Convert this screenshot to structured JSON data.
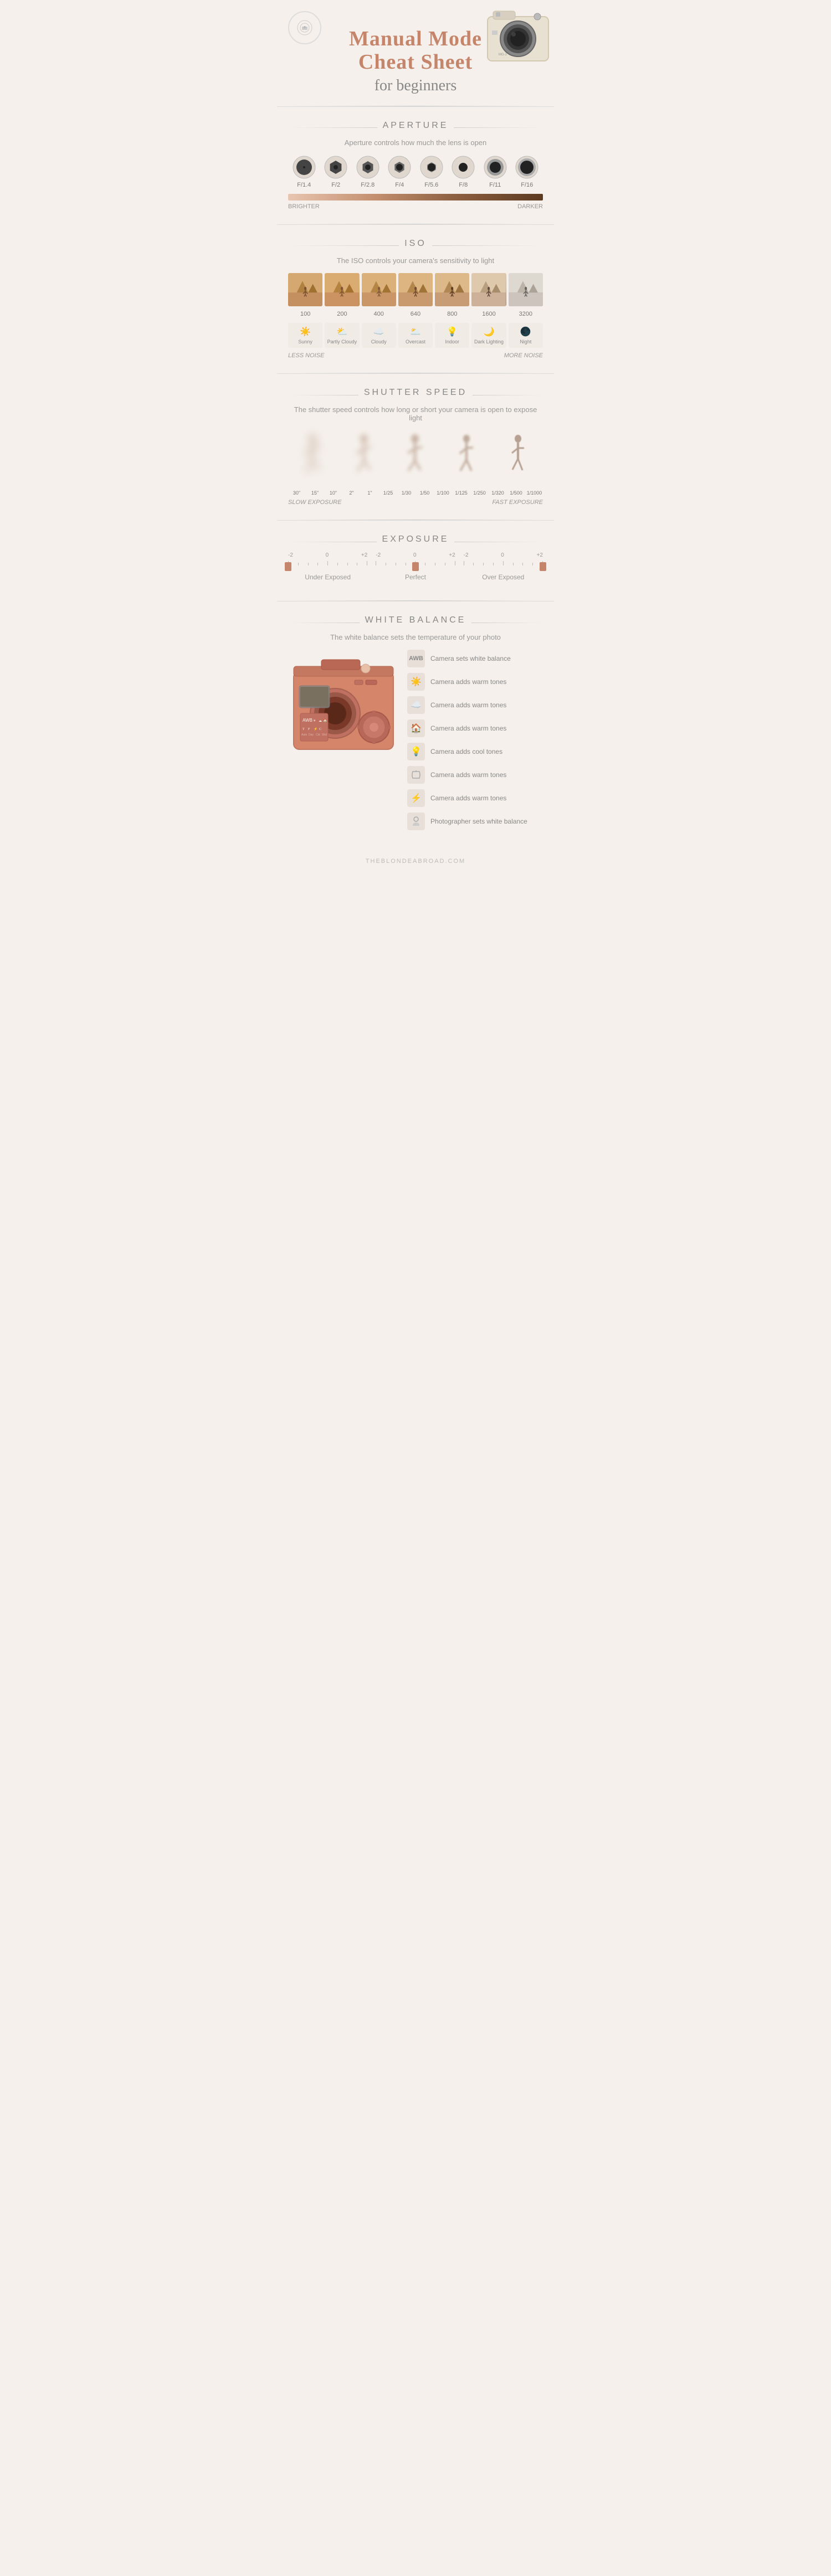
{
  "header": {
    "title_line1": "Manual Mode",
    "title_line2": "Cheat Sheet",
    "subtitle": "for beginners"
  },
  "aperture": {
    "section_title": "APERTURE",
    "description": "Aperture controls how much the lens is open",
    "values": [
      "F/1.4",
      "F/2",
      "F/2.8",
      "F/4",
      "F/5.6",
      "F/8",
      "F/11",
      "F/16"
    ],
    "bright_label": "BRIGHTER",
    "dark_label": "DARKER"
  },
  "iso": {
    "section_title": "ISO",
    "description": "The ISO controls your camera's sensitivity to light",
    "values": [
      "100",
      "200",
      "400",
      "640",
      "800",
      "1600",
      "3200"
    ],
    "weather": [
      {
        "icon": "☀️",
        "label": "Sunny"
      },
      {
        "icon": "⛅",
        "label": "Partly Cloudy"
      },
      {
        "icon": "☁️",
        "label": "Cloudy"
      },
      {
        "icon": "🌥️",
        "label": "Overcast"
      },
      {
        "icon": "💡",
        "label": "Indoor"
      },
      {
        "icon": "🌙",
        "label": "Dark Lighting"
      },
      {
        "icon": "🌑",
        "label": "Night"
      }
    ],
    "less_noise": "LESS NOISE",
    "more_noise": "MORE NOISE"
  },
  "shutter": {
    "section_title": "SHUTTER SPEED",
    "description": "The shutter speed controls how long or short your camera is open to expose light",
    "speeds": [
      "30\"",
      "15\"",
      "10\"",
      "2\"",
      "1\"",
      "1/25",
      "1/30",
      "1/50",
      "1/100",
      "1/125",
      "1/250",
      "1/320",
      "1/500",
      "1/1000"
    ],
    "slow_label": "SLOW EXPOSURE",
    "fast_label": "FAST EXPOSURE"
  },
  "exposure": {
    "section_title": "EXPOSURE",
    "items": [
      {
        "label": "Under Exposed",
        "ticks": [
          "-2",
          "",
          "0",
          "",
          "+2"
        ],
        "indicator_pos": "0"
      },
      {
        "label": "Perfect",
        "ticks": [
          "-2",
          "",
          "0",
          "",
          "+2"
        ],
        "indicator_pos": "50"
      },
      {
        "label": "Over Exposed",
        "ticks": [
          "-2",
          "",
          "0",
          "",
          "+2"
        ],
        "indicator_pos": "100"
      }
    ]
  },
  "white_balance": {
    "section_title": "WHITE BALANCE",
    "description": "The white balance sets the temperature of your photo",
    "items": [
      {
        "icon": "AWB",
        "icon_type": "text",
        "desc": "Camera sets white balance"
      },
      {
        "icon": "☀️",
        "icon_type": "emoji",
        "desc": "Camera adds warm tones"
      },
      {
        "icon": "☁️",
        "icon_type": "emoji",
        "desc": "Camera adds warm tones"
      },
      {
        "icon": "🏠",
        "icon_type": "emoji",
        "desc": "Camera adds warm tones"
      },
      {
        "icon": "💡",
        "icon_type": "emoji",
        "desc": "Camera adds cool tones"
      },
      {
        "icon": "〰️",
        "icon_type": "emoji",
        "desc": "Camera adds warm tones"
      },
      {
        "icon": "⚡",
        "icon_type": "emoji",
        "desc": "Camera adds warm tones"
      },
      {
        "icon": "👤",
        "icon_type": "emoji",
        "desc": "Photographer sets white balance"
      }
    ],
    "camera_labels": [
      "AWB",
      "Daylight",
      "Cloudy",
      "Shade",
      "Tungsten",
      "Fluorescent",
      "Flash",
      "Custom"
    ]
  },
  "footer": {
    "text": "THEBLONDEABROAD.COM"
  }
}
